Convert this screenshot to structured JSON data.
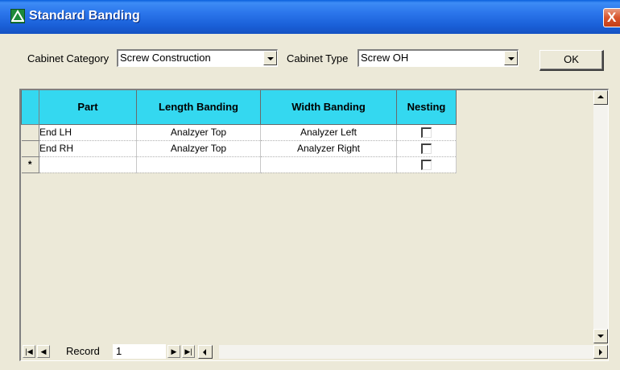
{
  "window": {
    "title": "Standard Banding",
    "close_label": "X"
  },
  "criteria": {
    "cabinet_category_label": "Cabinet Category",
    "cabinet_category_value": "Screw Construction",
    "cabinet_type_label": "Cabinet Type",
    "cabinet_type_value": "Screw OH",
    "ok_label": "OK"
  },
  "grid": {
    "columns": [
      "Part",
      "Length Banding",
      "Width Banding",
      "Nesting"
    ],
    "rows": [
      {
        "part": "End LH",
        "length_banding": "Analzyer Top",
        "width_banding": "Analyzer Left",
        "nesting": false
      },
      {
        "part": "End RH",
        "length_banding": "Analzyer Top",
        "width_banding": "Analyzer Right",
        "nesting": false
      }
    ],
    "new_row_marker": "*",
    "header_color": "#34d8f0"
  },
  "navigation": {
    "record_label": "Record",
    "record_value": "1",
    "first_symbol": "|◀",
    "prev_symbol": "◀",
    "next_symbol": "▶",
    "last_symbol": "▶|"
  },
  "icons": {
    "app": "app-triangle-icon",
    "close": "close-icon"
  }
}
